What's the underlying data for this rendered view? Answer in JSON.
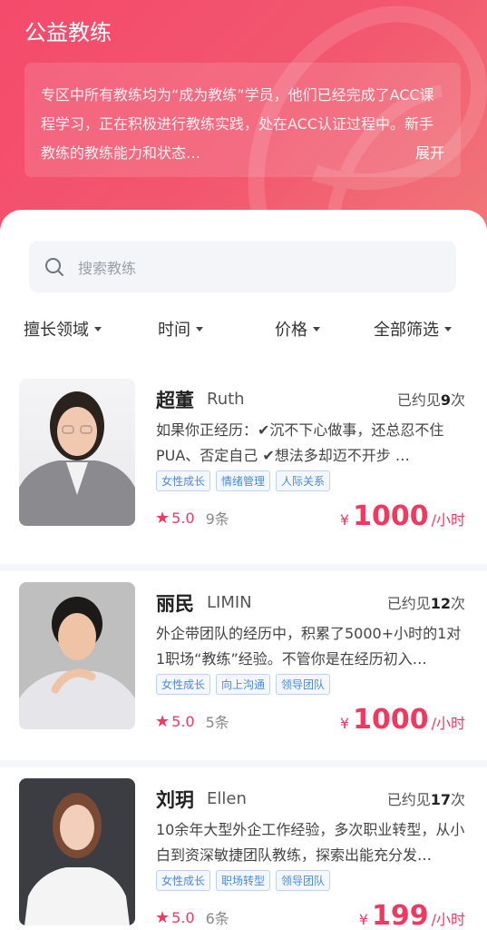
{
  "header": {
    "title": "公益教练",
    "intro": "专区中所有教练均为“成为教练”学员，他们已经完成了ACC课程学习，正在积极进行教练实践，处在ACC认证过程中。新手教练的教练能力和状态…",
    "more_label": "展开"
  },
  "search": {
    "placeholder": "搜索教练"
  },
  "filters": [
    {
      "label": "擅长领域"
    },
    {
      "label": "时间"
    },
    {
      "label": "价格"
    },
    {
      "label": "全部筛选"
    }
  ],
  "coaches": [
    {
      "name": "超董",
      "english_name": "Ruth",
      "met_prefix": "已约见",
      "met_count": "9",
      "met_suffix": "次",
      "desc": "如果你正经历：✔沉不下心做事，还总忍不住PUA、否定自己 ✔想法多却迈不开步 …",
      "tags": [
        "女性成长",
        "情绪管理",
        "人际关系"
      ],
      "rating": "5.0",
      "reviews": "9条",
      "currency": "¥",
      "price": "1000",
      "unit": "/小时"
    },
    {
      "name": "丽民",
      "english_name": "LIMIN",
      "met_prefix": "已约见",
      "met_count": "12",
      "met_suffix": "次",
      "desc": "外企带团队的经历中，积累了5000+小时的1对1职场“教练”经验。不管你是在经历初入…",
      "tags": [
        "女性成长",
        "向上沟通",
        "领导团队"
      ],
      "rating": "5.0",
      "reviews": "5条",
      "currency": "¥",
      "price": "1000",
      "unit": "/小时"
    },
    {
      "name": "刘玥",
      "english_name": "Ellen",
      "met_prefix": "已约见",
      "met_count": "17",
      "met_suffix": "次",
      "desc": "10余年大型外企工作经验，多次职业转型，从小白到资深敏捷团队教练，探索出能充分发…",
      "tags": [
        "女性成长",
        "职场转型",
        "领导团队"
      ],
      "rating": "5.0",
      "reviews": "6条",
      "currency": "¥",
      "price": "199",
      "unit": "/小时"
    }
  ]
}
